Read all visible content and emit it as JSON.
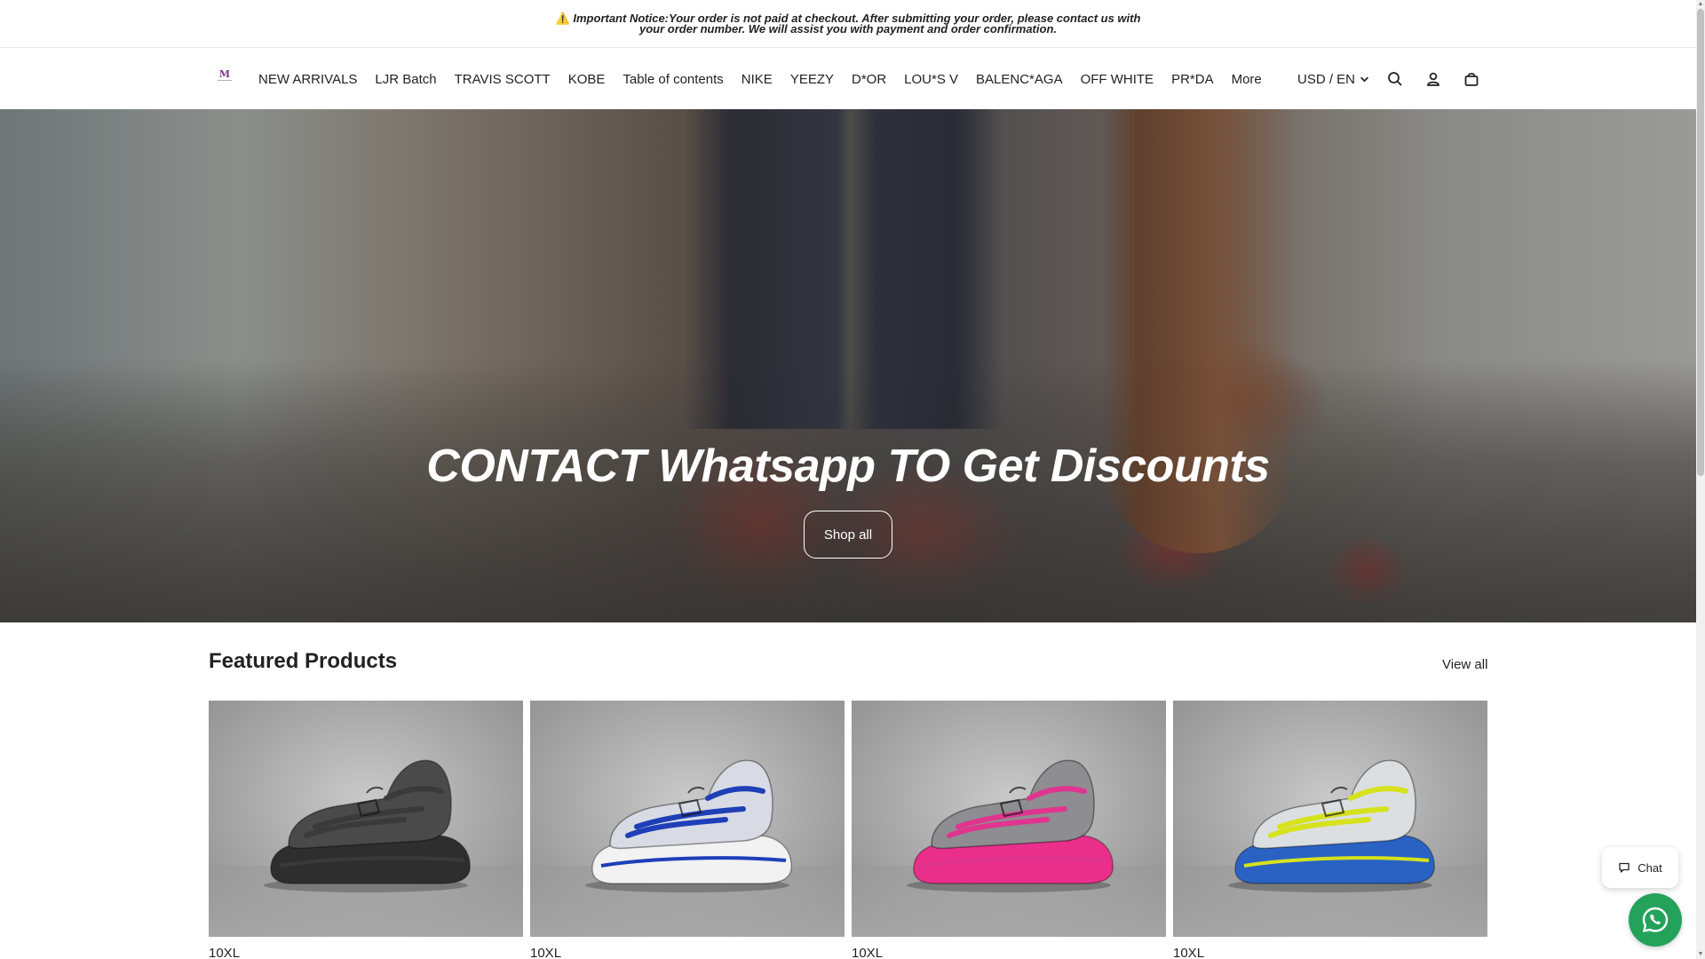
{
  "announcement": {
    "icon": "warning-icon",
    "label": "Important Notice:",
    "text": "Your order is not paid at checkout. After submitting your order, please contact us with your order number. We will assist you with payment and order confirmation."
  },
  "header": {
    "logo_text": "M",
    "nav": [
      "NEW ARRIVALS",
      "LJR Batch",
      "TRAVIS SCOTT",
      "KOBE",
      "Table of contents",
      "NIKE",
      "YEEZY",
      "D*OR",
      "LOU*S V",
      "BALENC*AGA",
      "OFF WHITE",
      "PR*DA",
      "More"
    ],
    "locale": "USD / EN",
    "icons": [
      "search-icon",
      "account-icon",
      "cart-icon"
    ]
  },
  "hero": {
    "title": "CONTACT Whatsapp TO Get Discounts",
    "button": "Shop all"
  },
  "featured": {
    "title": "Featured Products",
    "view_all": "View all",
    "products": [
      {
        "name": "10XL",
        "accent": "#3a3a3a",
        "sole": "#2e2e2e",
        "upper": "#4a4a4a"
      },
      {
        "name": "10XL",
        "accent": "#1f3fb8",
        "sole": "#f2f2f2",
        "upper": "#d8dbe4"
      },
      {
        "name": "10XL",
        "accent": "#e0358e",
        "sole": "#ea2f8a",
        "upper": "#8d8d92"
      },
      {
        "name": "10XL",
        "accent": "#d6e21c",
        "sole": "#2a62c4",
        "upper": "#dcdfe2"
      }
    ]
  },
  "widgets": {
    "chat_label": "Chat"
  }
}
